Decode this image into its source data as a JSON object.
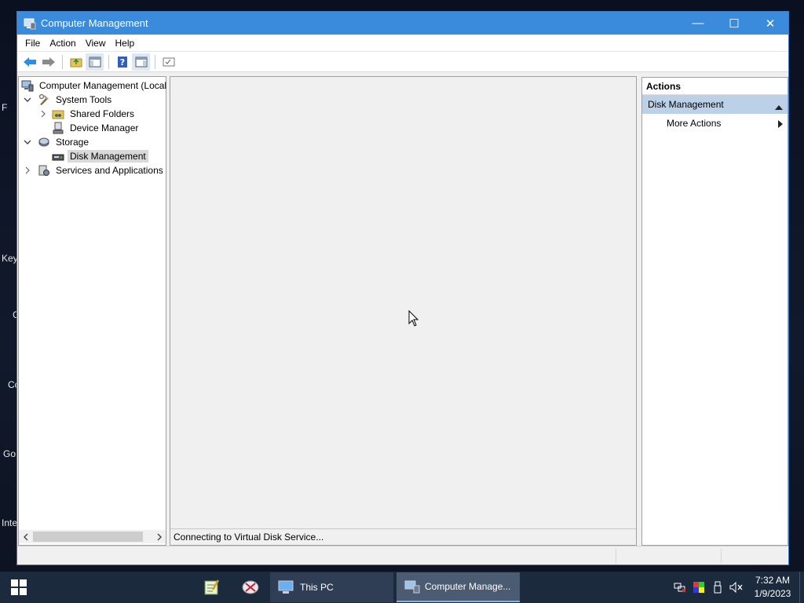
{
  "desktop": {
    "labels": [
      "F",
      "Key",
      "C",
      "Co",
      "Go",
      "Inte"
    ]
  },
  "window": {
    "title": "Computer Management",
    "minimize": "—",
    "maximize": "☐",
    "close": "✕"
  },
  "menu": [
    "File",
    "Action",
    "View",
    "Help"
  ],
  "tree": {
    "root": "Computer Management (Local",
    "system_tools": "System Tools",
    "shared_folders": "Shared Folders",
    "device_manager": "Device Manager",
    "storage": "Storage",
    "disk_management": "Disk Management",
    "services": "Services and Applications"
  },
  "center": {
    "status": "Connecting to Virtual Disk Service..."
  },
  "actions": {
    "header": "Actions",
    "section": "Disk Management",
    "more_actions": "More Actions"
  },
  "taskbar": {
    "this_pc": "This PC",
    "computer_management": "Computer Manage...",
    "time": "7:32 AM",
    "date": "1/9/2023"
  },
  "colors": {
    "titlebar": "#3a8bdc",
    "taskbar": "#1c2a3e",
    "actions_section": "#bcd0e8"
  }
}
